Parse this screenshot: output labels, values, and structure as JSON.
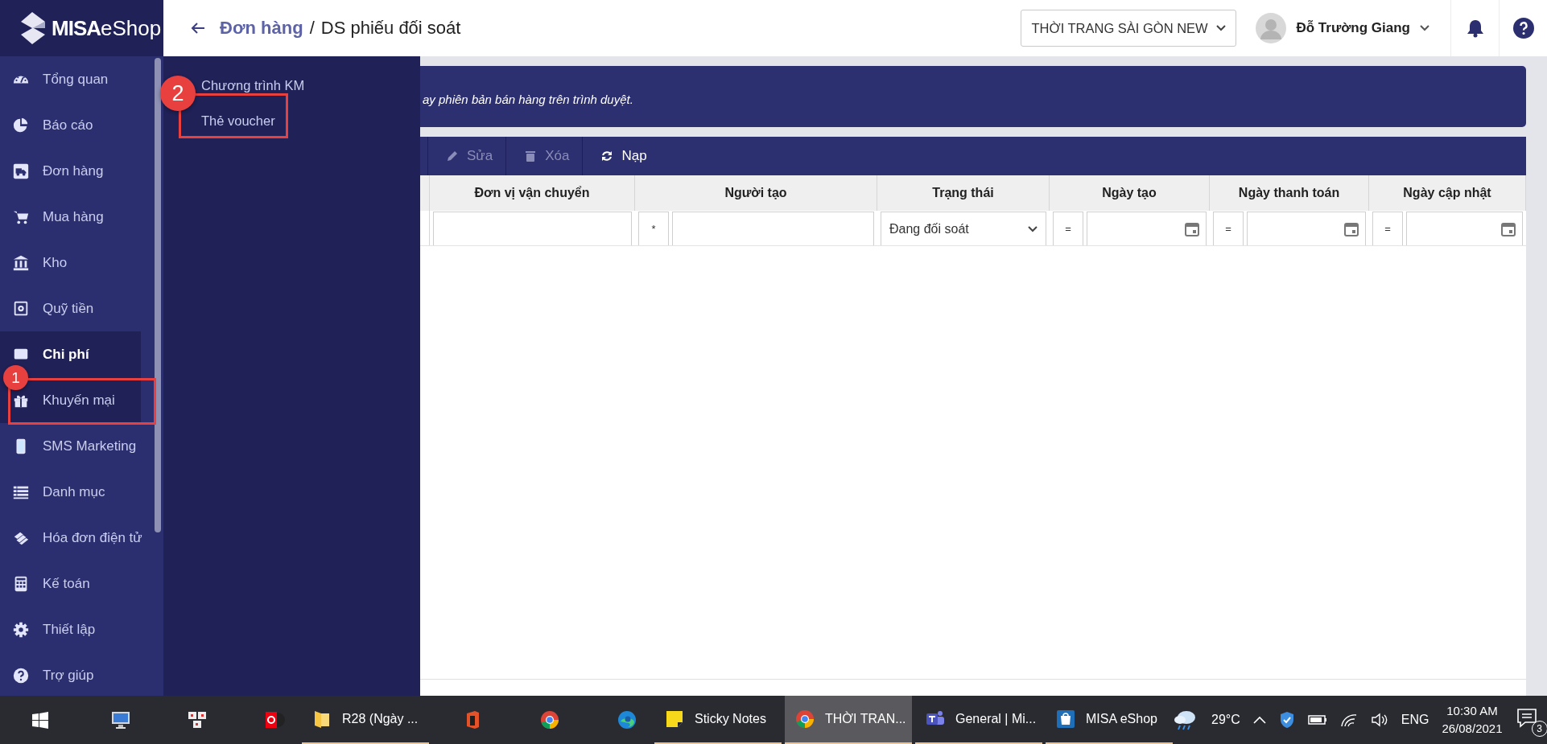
{
  "logo": {
    "brand": "MISA",
    "product": "eShop"
  },
  "sidebar": {
    "items": [
      {
        "label": "Tổng quan",
        "selected": false,
        "hovered": false
      },
      {
        "label": "Báo cáo",
        "selected": false,
        "hovered": false
      },
      {
        "label": "Đơn hàng",
        "selected": false,
        "hovered": false
      },
      {
        "label": "Mua hàng",
        "selected": false,
        "hovered": false
      },
      {
        "label": "Kho",
        "selected": false,
        "hovered": false
      },
      {
        "label": "Quỹ tiền",
        "selected": false,
        "hovered": false
      },
      {
        "label": "Chi phí",
        "selected": true,
        "hovered": false
      },
      {
        "label": "Khuyến mại",
        "selected": false,
        "hovered": true
      },
      {
        "label": "SMS Marketing",
        "selected": false,
        "hovered": false
      },
      {
        "label": "Danh mục",
        "selected": false,
        "hovered": false
      },
      {
        "label": "Hóa đơn điện tử",
        "selected": false,
        "hovered": false
      },
      {
        "label": "Kế toán",
        "selected": false,
        "hovered": false
      },
      {
        "label": "Thiết lập",
        "selected": false,
        "hovered": false
      },
      {
        "label": "Trợ giúp",
        "selected": false,
        "hovered": false
      }
    ]
  },
  "submenu": {
    "items": [
      {
        "label": "Chương trình KM"
      },
      {
        "label": "Thẻ voucher"
      }
    ]
  },
  "header": {
    "breadcrumb": [
      {
        "label": "Đơn hàng",
        "kind": "link"
      },
      {
        "label": "DS phiếu đối soát",
        "kind": "current"
      }
    ],
    "separator": "/",
    "store": "THỜI TRANG SÀI GÒN NEW",
    "user": "Đỗ Trường Giang"
  },
  "banner": {
    "text": "ay phiên bản bán hàng trên trình duyệt."
  },
  "toolbar": {
    "buttons": [
      {
        "label": "Sửa",
        "disabled": true
      },
      {
        "label": "Xóa",
        "disabled": true
      },
      {
        "label": "Nạp",
        "disabled": false
      }
    ]
  },
  "table": {
    "columns": [
      {
        "title": "Đơn vị vận chuyển",
        "filter": {
          "kind": "text"
        }
      },
      {
        "title": "Người tạo",
        "filter": {
          "kind": "text",
          "operator": "*"
        }
      },
      {
        "title": "Trạng thái",
        "filter": {
          "kind": "select",
          "value": "Đang đối soát"
        }
      },
      {
        "title": "Ngày tạo",
        "filter": {
          "kind": "date",
          "operator": "="
        }
      },
      {
        "title": "Ngày thanh toán",
        "filter": {
          "kind": "date",
          "operator": "="
        }
      },
      {
        "title": "Ngày cập nhật",
        "filter": {
          "kind": "date",
          "operator": "="
        }
      }
    ]
  },
  "annotations": [
    {
      "number": "1"
    },
    {
      "number": "2"
    }
  ],
  "taskbar": {
    "items": [
      {
        "active": false
      },
      {
        "active": false
      },
      {
        "active": false
      },
      {
        "active": false
      },
      {
        "label": "R28 (Ngày ...",
        "active": false
      },
      {
        "active": false
      },
      {
        "active": false
      },
      {
        "active": false
      },
      {
        "label": "Sticky Notes",
        "active": false
      },
      {
        "label": "THỜI TRAN...",
        "active": true
      },
      {
        "label": "General | Mi...",
        "active": false
      },
      {
        "label": "MISA eShop",
        "active": false
      }
    ],
    "weather": "29°C",
    "language": "ENG",
    "time": "10:30 AM",
    "date": "26/08/2021",
    "notifications": "3"
  }
}
